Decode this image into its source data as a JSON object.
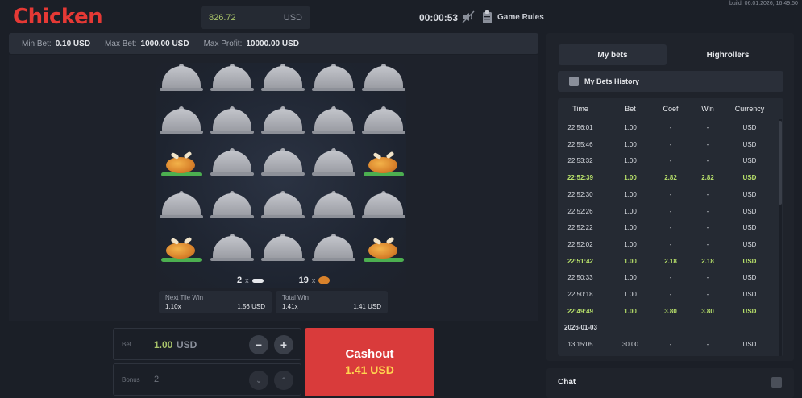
{
  "app": {
    "title": "Chicken",
    "build": "build: 06.01.2026, 16:49:50"
  },
  "header": {
    "balance_amount": "826.72",
    "balance_currency": "USD",
    "timer": "00:00:53",
    "game_rules_label": "Game Rules"
  },
  "limits": {
    "min_bet_label": "Min Bet:",
    "min_bet_value": "0.10 USD",
    "max_bet_label": "Max Bet:",
    "max_bet_value": "1000.00 USD",
    "max_profit_label": "Max Profit:",
    "max_profit_value": "10000.00 USD"
  },
  "board": {
    "rows": [
      [
        "cloche",
        "cloche",
        "cloche",
        "cloche",
        "cloche"
      ],
      [
        "cloche",
        "cloche",
        "cloche",
        "cloche",
        "cloche"
      ],
      [
        "chicken",
        "cloche",
        "cloche",
        "cloche",
        "chicken"
      ],
      [
        "cloche",
        "cloche",
        "cloche",
        "cloche",
        "cloche"
      ],
      [
        "chicken",
        "cloche",
        "cloche",
        "cloche",
        "chicken"
      ]
    ],
    "bones_count": "2",
    "chickens_count": "19",
    "x_sign": "x"
  },
  "next_tile_win": {
    "label": "Next Tile Win",
    "multiplier": "1.10x",
    "amount": "1.56 USD"
  },
  "total_win": {
    "label": "Total Win",
    "multiplier": "1.41x",
    "amount": "1.41 USD"
  },
  "bet": {
    "label": "Bet",
    "value": "1.00",
    "currency": "USD",
    "minus": "−",
    "plus": "+"
  },
  "bonus": {
    "label": "Bonus",
    "value": "2",
    "down": "⌄",
    "up": "⌃"
  },
  "cashout": {
    "label": "Cashout",
    "amount": "1.41 USD"
  },
  "sidebar": {
    "tabs": [
      {
        "label": "My bets"
      },
      {
        "label": "Highrollers"
      }
    ],
    "history_title": "My Bets History",
    "columns": [
      "Time",
      "Bet",
      "Coef",
      "Win",
      "Currency"
    ],
    "rows": [
      {
        "time": "22:56:01",
        "bet": "1.00",
        "coef": "-",
        "win": "-",
        "currency": "USD",
        "won": false
      },
      {
        "time": "22:55:46",
        "bet": "1.00",
        "coef": "-",
        "win": "-",
        "currency": "USD",
        "won": false
      },
      {
        "time": "22:53:32",
        "bet": "1.00",
        "coef": "-",
        "win": "-",
        "currency": "USD",
        "won": false
      },
      {
        "time": "22:52:39",
        "bet": "1.00",
        "coef": "2.82",
        "win": "2.82",
        "currency": "USD",
        "won": true
      },
      {
        "time": "22:52:30",
        "bet": "1.00",
        "coef": "-",
        "win": "-",
        "currency": "USD",
        "won": false
      },
      {
        "time": "22:52:26",
        "bet": "1.00",
        "coef": "-",
        "win": "-",
        "currency": "USD",
        "won": false
      },
      {
        "time": "22:52:22",
        "bet": "1.00",
        "coef": "-",
        "win": "-",
        "currency": "USD",
        "won": false
      },
      {
        "time": "22:52:02",
        "bet": "1.00",
        "coef": "-",
        "win": "-",
        "currency": "USD",
        "won": false
      },
      {
        "time": "22:51:42",
        "bet": "1.00",
        "coef": "2.18",
        "win": "2.18",
        "currency": "USD",
        "won": true
      },
      {
        "time": "22:50:33",
        "bet": "1.00",
        "coef": "-",
        "win": "-",
        "currency": "USD",
        "won": false
      },
      {
        "time": "22:50:18",
        "bet": "1.00",
        "coef": "-",
        "win": "-",
        "currency": "USD",
        "won": false
      },
      {
        "time": "22:49:49",
        "bet": "1.00",
        "coef": "3.80",
        "win": "3.80",
        "currency": "USD",
        "won": true
      },
      {
        "date": "2026-01-03"
      },
      {
        "time": "13:15:05",
        "bet": "30.00",
        "coef": "-",
        "win": "-",
        "currency": "USD",
        "won": false
      }
    ]
  },
  "chat": {
    "label": "Chat"
  },
  "colors": {
    "brand": "#e53935",
    "cashout": "#d93b3b",
    "win_green": "#b7e06a",
    "amount_yellow": "#ffd54f"
  }
}
